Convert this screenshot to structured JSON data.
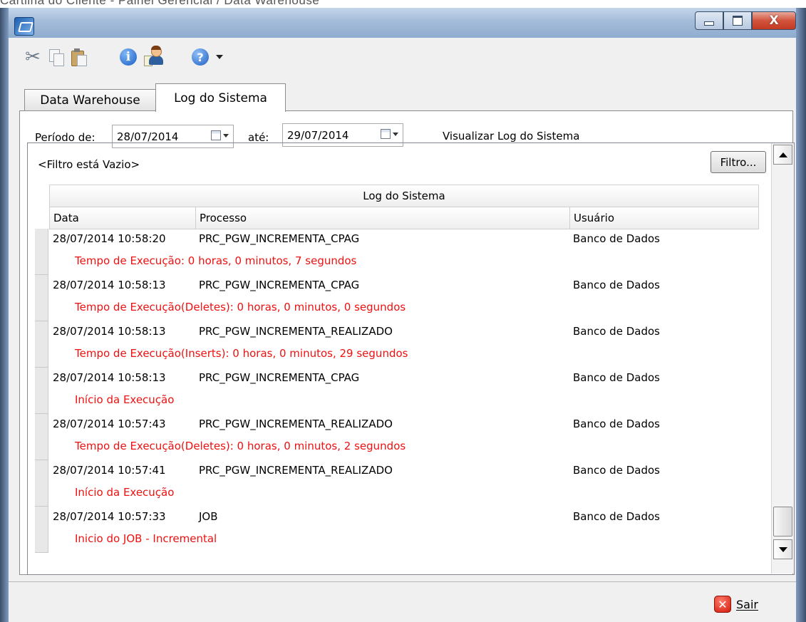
{
  "caption": "Cartilha do Cliente - Painel Gerencial / Data Warehouse",
  "window": {
    "min_icon": "window-minimize-icon",
    "max_icon": "window-maximize-icon",
    "close_label": "X"
  },
  "toolbar": {
    "icons": [
      "scissors-icon",
      "copy-icon",
      "paste-icon",
      "info-icon",
      "user-icon",
      "help-icon",
      "chevron-down-icon"
    ]
  },
  "tabs": [
    {
      "label": "Data Warehouse",
      "active": false
    },
    {
      "label": "Log do Sistema",
      "active": true
    }
  ],
  "period": {
    "from_label": "Período de:",
    "from_value": "28/07/2014",
    "to_label": "até:",
    "to_value": "29/07/2014",
    "view_label": "Visualizar Log do Sistema"
  },
  "filter": {
    "text": "<Filtro está Vazio>",
    "button_label": "Filtro..."
  },
  "grid": {
    "group_header": "Log do Sistema",
    "columns": [
      "Data",
      "Processo",
      "Usuário"
    ],
    "rows": [
      {
        "data": "28/07/2014 10:58:20",
        "processo": "PRC_PGW_INCREMENTA_CPAG",
        "usuario": "Banco de Dados",
        "detalhe": "Tempo de Execução: 0 horas, 0 minutos, 7 segundos"
      },
      {
        "data": "28/07/2014 10:58:13",
        "processo": "PRC_PGW_INCREMENTA_CPAG",
        "usuario": "Banco de Dados",
        "detalhe": "Tempo de Execução(Deletes): 0 horas, 0 minutos, 0 segundos"
      },
      {
        "data": "28/07/2014 10:58:13",
        "processo": "PRC_PGW_INCREMENTA_REALIZADO",
        "usuario": "Banco de Dados",
        "detalhe": "Tempo de Execução(Inserts): 0 horas, 0 minutos, 29 segundos"
      },
      {
        "data": "28/07/2014 10:58:13",
        "processo": "PRC_PGW_INCREMENTA_CPAG",
        "usuario": "Banco de Dados",
        "detalhe": "Início da Execução"
      },
      {
        "data": "28/07/2014 10:57:43",
        "processo": "PRC_PGW_INCREMENTA_REALIZADO",
        "usuario": "Banco de Dados",
        "detalhe": "Tempo de Execução(Deletes): 0 horas, 0 minutos, 2 segundos"
      },
      {
        "data": "28/07/2014 10:57:41",
        "processo": "PRC_PGW_INCREMENTA_REALIZADO",
        "usuario": "Banco de Dados",
        "detalhe": "Início da Execução"
      },
      {
        "data": "28/07/2014 10:57:33",
        "processo": "JOB",
        "usuario": "Banco de Dados",
        "detalhe": "Inicio do JOB - Incremental"
      }
    ]
  },
  "footer": {
    "exit_label": "Sair",
    "exit_icon": "close-icon"
  },
  "colors": {
    "detail_text": "#ee1111",
    "window_frame": "#6d8cb3"
  }
}
